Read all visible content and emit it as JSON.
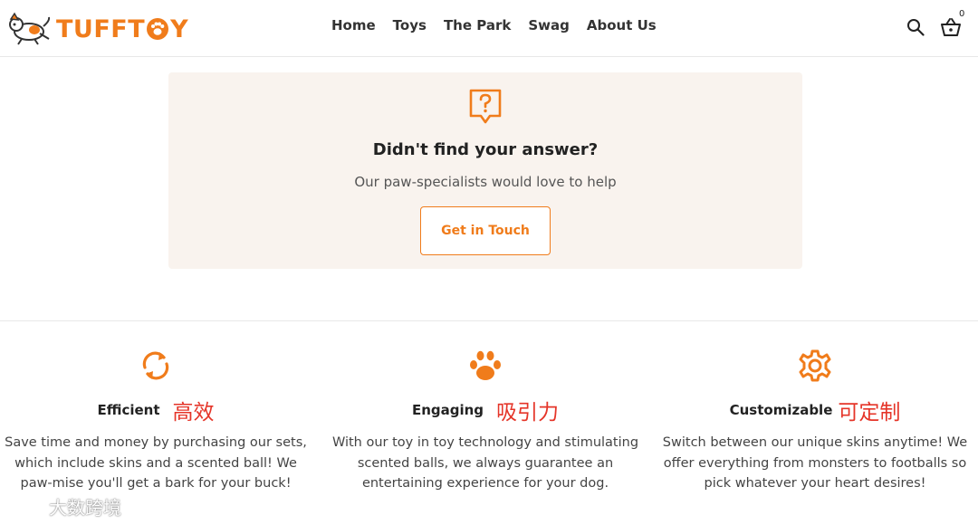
{
  "header": {
    "brand": "TUFFTOY",
    "brand_parts": {
      "left": "TUFFT",
      "right": "Y"
    },
    "nav": [
      "Home",
      "Toys",
      "The Park",
      "Swag",
      "About Us"
    ],
    "cart_count": "0",
    "icons": {
      "search": "search-icon",
      "cart": "basket-icon"
    }
  },
  "help": {
    "title": "Didn't find your answer?",
    "subtitle": "Our paw-specialists would love to help",
    "button": "Get in Touch",
    "icon": "question-bubble-icon"
  },
  "features": [
    {
      "icon": "refresh-icon",
      "title": "Efficient",
      "cn": "高效",
      "text": "Save time and money by purchasing our sets, which include skins and a scented ball! We paw-mise you'll get a bark for your buck!"
    },
    {
      "icon": "paw-icon",
      "title": "Engaging",
      "cn": "吸引力",
      "text": "With our toy in toy technology and stimulating scented balls, we always guarantee an entertaining experience for your dog."
    },
    {
      "icon": "gear-icon",
      "title": "Customizable",
      "cn": "可定制",
      "text": "Switch between our unique skins anytime! We offer everything from monsters to footballs so pick whatever your heart desires!"
    }
  ],
  "watermark": "大数跨境",
  "colors": {
    "accent": "#f07c1b",
    "card_bg": "#f9f3ee",
    "cn_red": "#e53529",
    "text": "#222222"
  }
}
